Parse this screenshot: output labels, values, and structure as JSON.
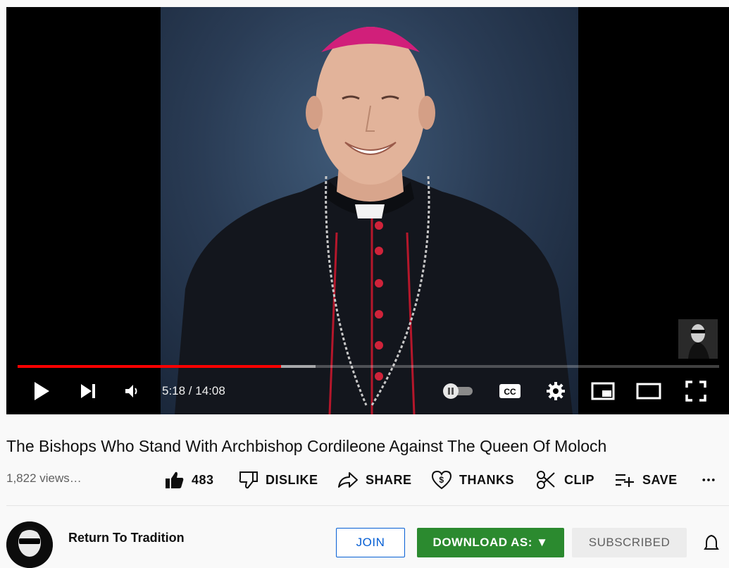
{
  "player": {
    "time_current": "5:18",
    "time_total": "14:08",
    "time_display": "5:18 / 14:08",
    "progress_played_fraction": 0.376,
    "progress_buffered_fraction": 0.425,
    "icons": [
      "play-icon",
      "next-icon",
      "volume-icon",
      "autoplay-toggle",
      "cc-icon",
      "settings-icon",
      "miniplayer-icon",
      "theater-icon",
      "fullscreen-icon"
    ],
    "accent_color": "#ff0000"
  },
  "video": {
    "title": "The Bishops Who Stand With Archbishop Cordileone Against The Queen Of Moloch",
    "views": "1,822 views…"
  },
  "actions": {
    "like_count": "483",
    "dislike_label": "DISLIKE",
    "share_label": "SHARE",
    "thanks_label": "THANKS",
    "clip_label": "CLIP",
    "save_label": "SAVE",
    "more": "…"
  },
  "channel": {
    "name": "Return To Tradition",
    "join_label": "JOIN",
    "download_label": "DOWNLOAD AS: ▼",
    "subscribed_label": "SUBSCRIBED",
    "download_color": "#2b8a2f"
  }
}
